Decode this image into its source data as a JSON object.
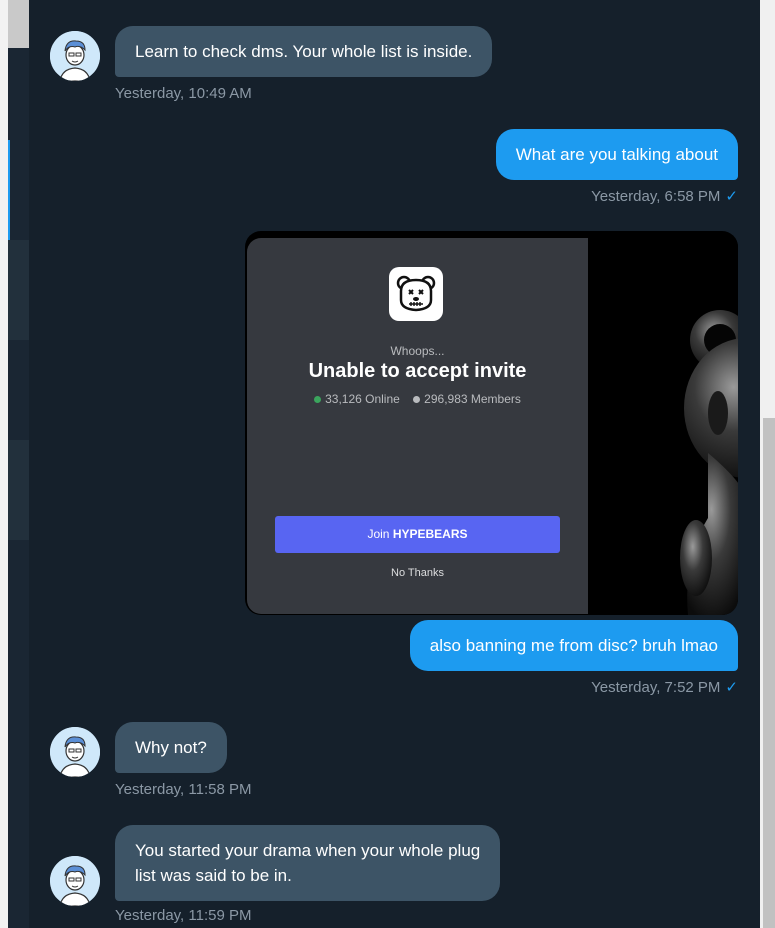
{
  "messages": [
    {
      "direction": "incoming",
      "text": "Learn to check dms. Your whole list is inside.",
      "time": "Yesterday, 10:49 AM"
    },
    {
      "direction": "outgoing",
      "text": "What are you talking about",
      "time": "Yesterday, 6:58 PM",
      "status_icon": "check-icon"
    },
    {
      "direction": "outgoing",
      "type": "image",
      "attachment": {
        "subtitle": "Whoops...",
        "title": "Unable to accept invite",
        "online": "33,126 Online",
        "members": "296,983 Members",
        "join_prefix": "Join ",
        "join_server": "HYPEBEARS",
        "decline": "No Thanks",
        "icon": "bear-skull-icon"
      }
    },
    {
      "direction": "outgoing",
      "text": "also banning me from disc? bruh lmao",
      "time": "Yesterday, 7:52 PM",
      "status_icon": "check-icon"
    },
    {
      "direction": "incoming",
      "text": "Why not?",
      "time": "Yesterday, 11:58 PM"
    },
    {
      "direction": "incoming",
      "lines": [
        "You started your drama when your whole plug",
        "list was said to be in."
      ],
      "time": "Yesterday, 11:59 PM"
    }
  ],
  "colors": {
    "background": "#15202b",
    "incoming_bubble": "#3d5466",
    "outgoing_bubble": "#1d9bf0",
    "timestamp": "#8b98a5",
    "discord_bg": "#36393f",
    "discord_button": "#5865f2",
    "online_dot": "#3ba55d",
    "members_dot": "#b9bbbe"
  },
  "glyphs": {
    "check": "✓"
  }
}
